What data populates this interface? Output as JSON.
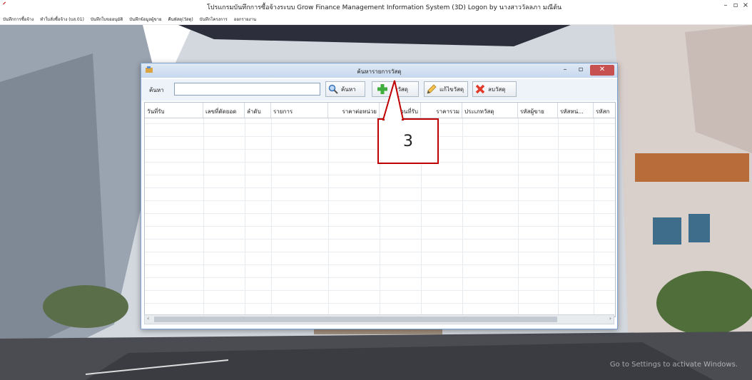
{
  "app": {
    "title": "โปรแกรมบันทึกการซื้อจ้างระบบ  Grow Finance Management Information System (3D) Logon by นางสาววัลลภา  มณีต้น",
    "window_buttons": [
      "–",
      "▫",
      "×"
    ],
    "menu": [
      "บันทึกการซื้อจ้าง",
      "ทำใบสั่งซื้อจ้าง (บส.01)",
      "บันทึกใบขออนุมัติ",
      "บันทึกข้อมูลผู้ขาย",
      "คืนพัสดุ(วัสดุ)",
      "บันทึกโครงการ",
      "ออกรายงาน"
    ]
  },
  "dialog": {
    "title": "ค้นหารายการวัสดุ",
    "search_label": "ค้นหา",
    "search_value": "",
    "buttons": {
      "search": "ค้นหา",
      "receive": "รับวัสดุ",
      "edit": "แก้ไขวัสดุ",
      "delete": "ลบวัสดุ"
    },
    "columns": [
      "วันที่รับ",
      "เลขที่ตัดยอด",
      "ลำดับ",
      "รายการ",
      "ราคาต่อหน่วย",
      "จำนวนที่รับ",
      "ราคารวม",
      "ประเภทวัสดุ",
      "รหัสผู้ขาย",
      "รหัสหน่...",
      "รหัสก"
    ]
  },
  "annotation": {
    "label": "3"
  },
  "watermark": "Go to Settings to activate Windows.",
  "colors": {
    "callout": "#c00000",
    "dialog_border": "#7da2ce",
    "close_button": "#c75050"
  }
}
